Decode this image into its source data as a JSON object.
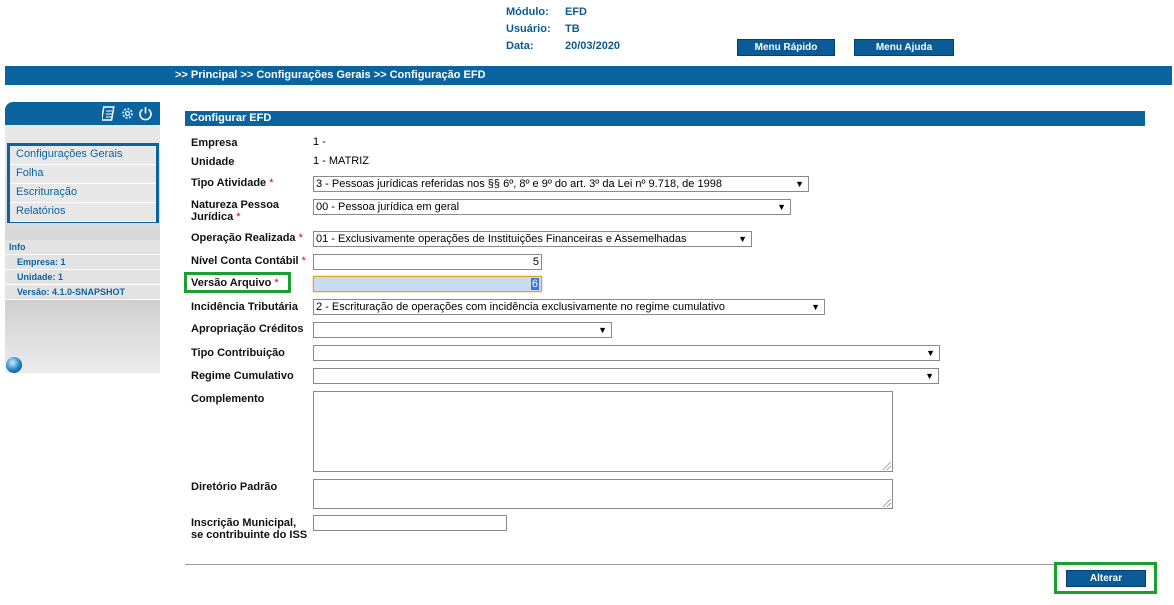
{
  "header": {
    "modulo_label": "Módulo:",
    "modulo_value": "EFD",
    "usuario_label": "Usuário:",
    "usuario_value": "TB",
    "data_label": "Data:",
    "data_value": "20/03/2020",
    "menu_rapido": "Menu Rápido",
    "menu_ajuda": "Menu Ajuda"
  },
  "breadcrumb": ">> Principal >> Configurações Gerais >> Configuração EFD",
  "sidebar": {
    "icons": [
      "calculator-icon",
      "gear-icon",
      "power-icon"
    ],
    "menu": [
      "Configurações Gerais",
      "Folha",
      "Escrituração",
      "Relatórios"
    ],
    "info_title": "Info",
    "info": [
      "Empresa: 1",
      "Unidade: 1",
      "Versão: 4.1.0-SNAPSHOT"
    ]
  },
  "form": {
    "title": "Configurar EFD",
    "required_mark": "*",
    "empresa_label": "Empresa",
    "empresa_value": "1 -",
    "unidade_label": "Unidade",
    "unidade_value": "1 - MATRIZ",
    "tipo_atividade_label": "Tipo Atividade",
    "tipo_atividade_value": "3 - Pessoas jurídicas referidas nos §§ 6º, 8º e 9º do art. 3º da Lei nº 9.718, de 1998",
    "natureza_label_1": "Natureza Pessoa",
    "natureza_label_2": "Jurídica",
    "natureza_value": "00 - Pessoa jurídica em geral",
    "operacao_label": "Operação Realizada",
    "operacao_value": "01 - Exclusivamente operações de Instituições Financeiras e Assemelhadas",
    "nivel_label": "Nível Conta Contábil",
    "nivel_value": "5",
    "versao_label": "Versão Arquivo",
    "versao_value": "6",
    "incidencia_label": "Incidência Tributária",
    "incidencia_value": "2 - Escrituração de operações com incidência exclusivamente no regime cumulativo",
    "apropriacao_label": "Apropriação Créditos",
    "apropriacao_value": "",
    "tipo_contrib_label": "Tipo Contribuição",
    "tipo_contrib_value": "",
    "regime_label": "Regime Cumulativo",
    "regime_value": "",
    "complemento_label": "Complemento",
    "diretorio_label": "Diretório Padrão",
    "inscricao_label_1": "Inscrição Municipal,",
    "inscricao_label_2": "se contribuinte do ISS",
    "inscricao_value": "",
    "alterar": "Alterar"
  },
  "colors": {
    "primary_blue": "#0b639f",
    "highlight_green": "#18a030",
    "required_red": "#d00000"
  }
}
